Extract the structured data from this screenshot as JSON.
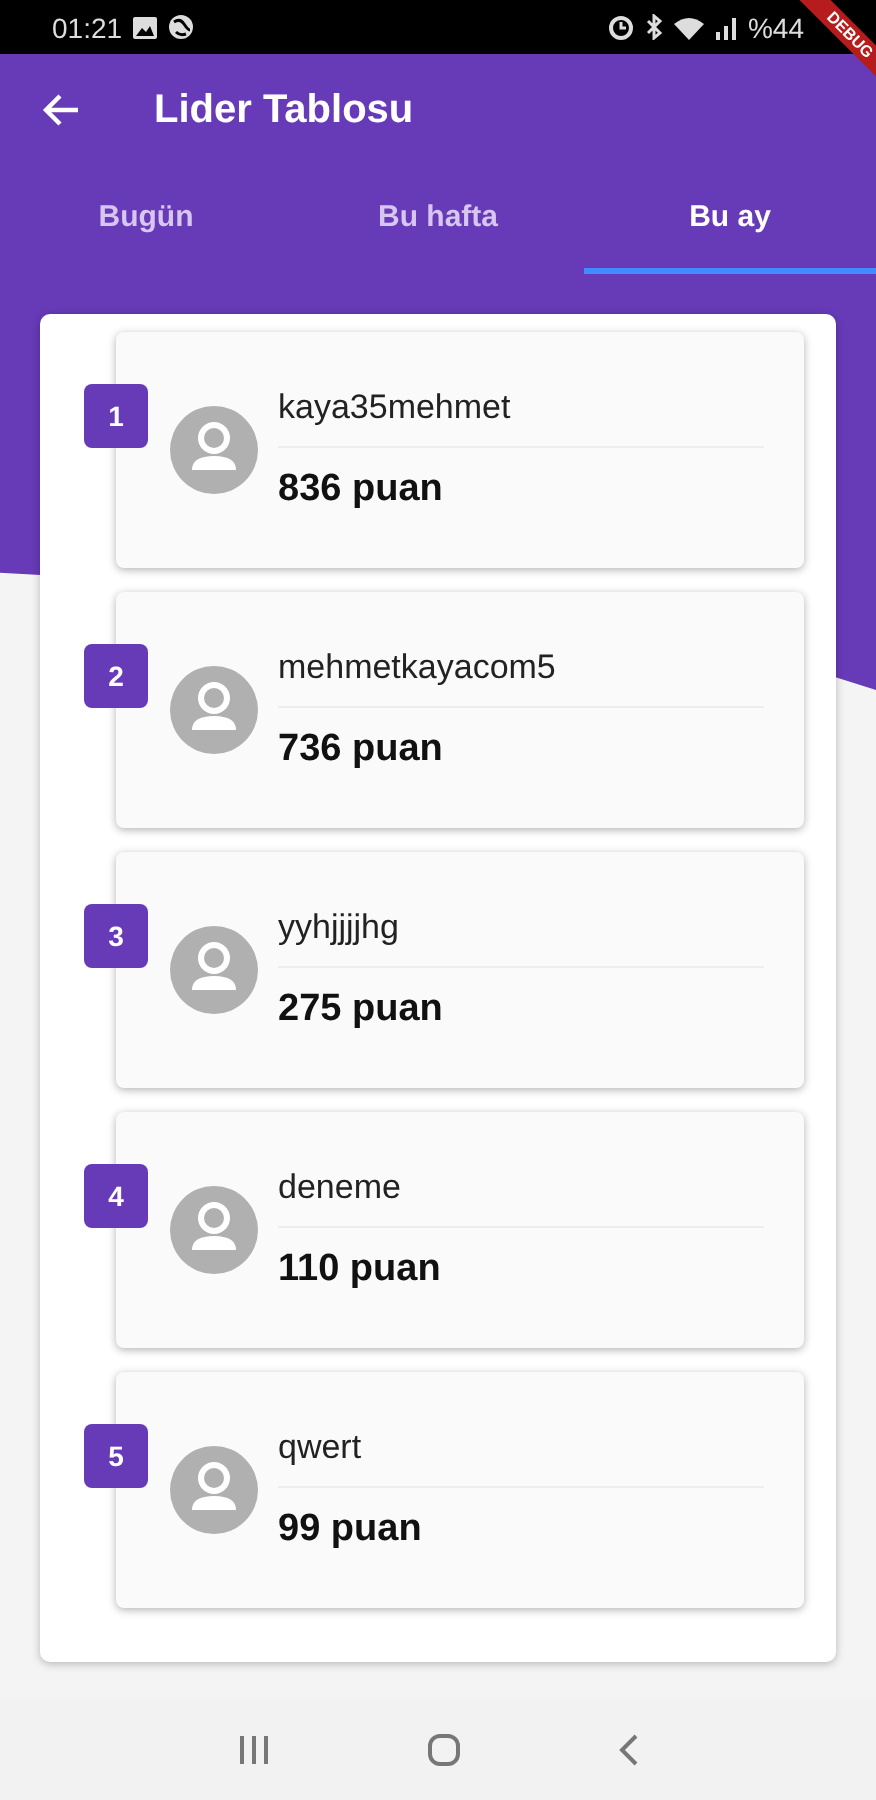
{
  "status_bar": {
    "time": "01:21",
    "battery": "%44"
  },
  "debug_banner": {
    "label": "DEBUG"
  },
  "app_bar": {
    "title": "Lider Tablosu"
  },
  "tabs": [
    {
      "label": "Bugün",
      "selected": false
    },
    {
      "label": "Bu hafta",
      "selected": false
    },
    {
      "label": "Bu ay",
      "selected": true
    }
  ],
  "leaderboard": [
    {
      "rank": "1",
      "username": "kaya35mehmet",
      "points": "836 puan"
    },
    {
      "rank": "2",
      "username": "mehmetkayacom5",
      "points": "736 puan"
    },
    {
      "rank": "3",
      "username": "yyhjjjjhg",
      "points": "275 puan"
    },
    {
      "rank": "4",
      "username": "deneme",
      "points": "110 puan"
    },
    {
      "rank": "5",
      "username": "qwert",
      "points": "99 puan"
    }
  ]
}
